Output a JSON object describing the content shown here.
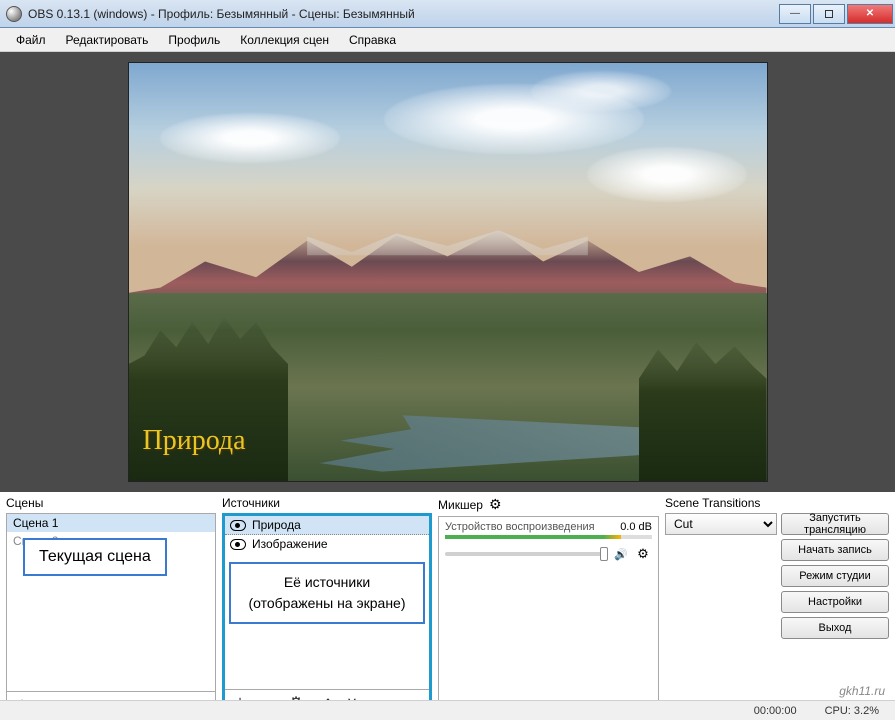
{
  "window": {
    "title": "OBS 0.13.1 (windows) - Профиль: Безымянный - Сцены: Безымянный"
  },
  "menu": {
    "file": "Файл",
    "edit": "Редактировать",
    "profile": "Профиль",
    "scene_collection": "Коллекция сцен",
    "help": "Справка"
  },
  "preview": {
    "overlay_text": "Природа"
  },
  "scenes": {
    "title": "Сцены",
    "items": [
      "Сцена 1",
      "Сцена 2"
    ],
    "callout": "Текущая сцена"
  },
  "sources": {
    "title": "Источники",
    "items": [
      "Природа",
      "Изображение"
    ],
    "callout_line1": "Её источники",
    "callout_line2": "(отображены на экране)"
  },
  "mixer": {
    "title": "Микшер",
    "channel_name": "Устройство воспроизведения",
    "db_value": "0.0 dB"
  },
  "transitions": {
    "title": "Scene Transitions",
    "selected": "Cut"
  },
  "buttons": {
    "start_stream": "Запустить трансляцию",
    "start_record": "Начать запись",
    "studio_mode": "Режим студии",
    "settings": "Настройки",
    "exit": "Выход"
  },
  "status": {
    "time": "00:00:00",
    "cpu": "CPU: 3.2%"
  },
  "watermark": "gkh11.ru"
}
